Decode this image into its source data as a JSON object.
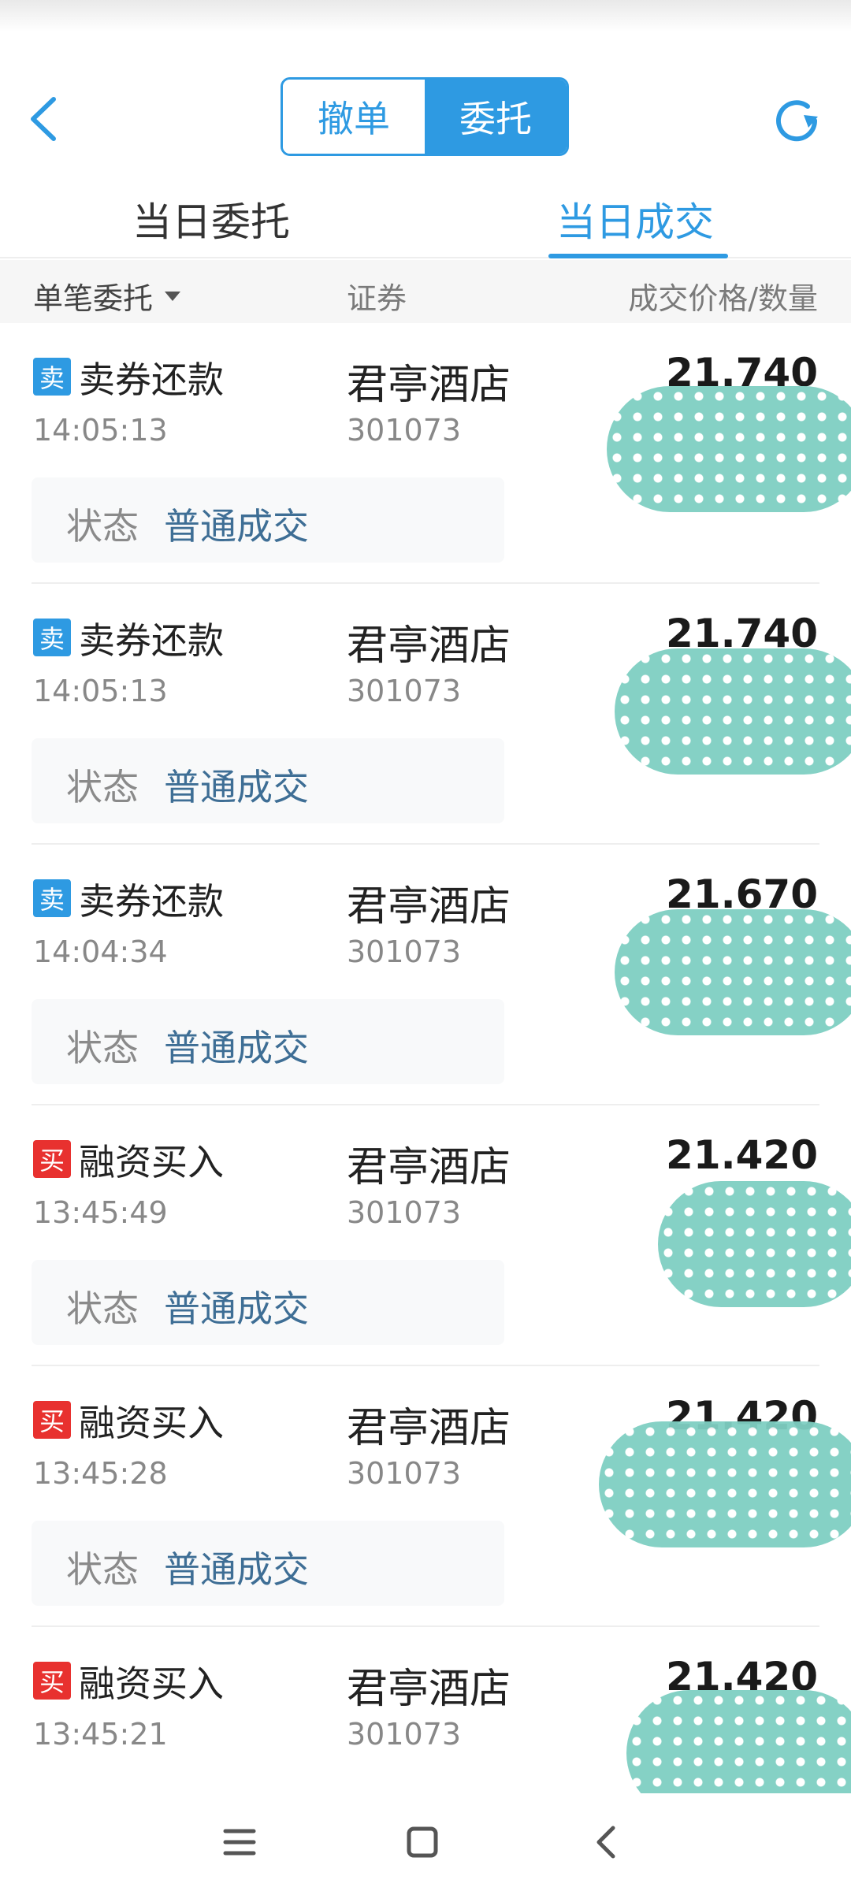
{
  "header": {
    "segment": {
      "cancel_label": "撤单",
      "entrust_label": "委托",
      "active": "委托"
    }
  },
  "tabs": [
    {
      "label": "当日委托",
      "active": false
    },
    {
      "label": "当日成交",
      "active": true
    }
  ],
  "columns": {
    "filter_label": "单笔委托",
    "security_label": "证券",
    "price_qty_label": "成交价格/数量"
  },
  "trades": [
    {
      "side": "sell",
      "badge": "卖",
      "op": "卖券还款",
      "time": "14:05:13",
      "name": "君亭酒店",
      "code": "301073",
      "price": "21.740",
      "status_label": "状态",
      "status": "普通成交"
    },
    {
      "side": "sell",
      "badge": "卖",
      "op": "卖券还款",
      "time": "14:05:13",
      "name": "君亭酒店",
      "code": "301073",
      "price": "21.740",
      "status_label": "状态",
      "status": "普通成交"
    },
    {
      "side": "sell",
      "badge": "卖",
      "op": "卖券还款",
      "time": "14:04:34",
      "name": "君亭酒店",
      "code": "301073",
      "price": "21.670",
      "status_label": "状态",
      "status": "普通成交"
    },
    {
      "side": "buy",
      "badge": "买",
      "op": "融资买入",
      "time": "13:45:49",
      "name": "君亭酒店",
      "code": "301073",
      "price": "21.420",
      "status_label": "状态",
      "status": "普通成交"
    },
    {
      "side": "buy",
      "badge": "买",
      "op": "融资买入",
      "time": "13:45:28",
      "name": "君亭酒店",
      "code": "301073",
      "price": "21.420",
      "status_label": "状态",
      "status": "普通成交"
    },
    {
      "side": "buy",
      "badge": "买",
      "op": "融资买入",
      "time": "13:45:21",
      "name": "君亭酒店",
      "code": "301073",
      "price": "21.420",
      "status_label": "状态",
      "status": "普通成交"
    }
  ],
  "colors": {
    "accent": "#2e9ae2",
    "sell": "#2e9ae2",
    "buy": "#e8312f",
    "status_text": "#3e6e95",
    "redaction": "#7fcfc2"
  },
  "icons": {
    "back": "chevron-left-icon",
    "refresh": "refresh-icon",
    "sort": "triangle-down-icon"
  }
}
